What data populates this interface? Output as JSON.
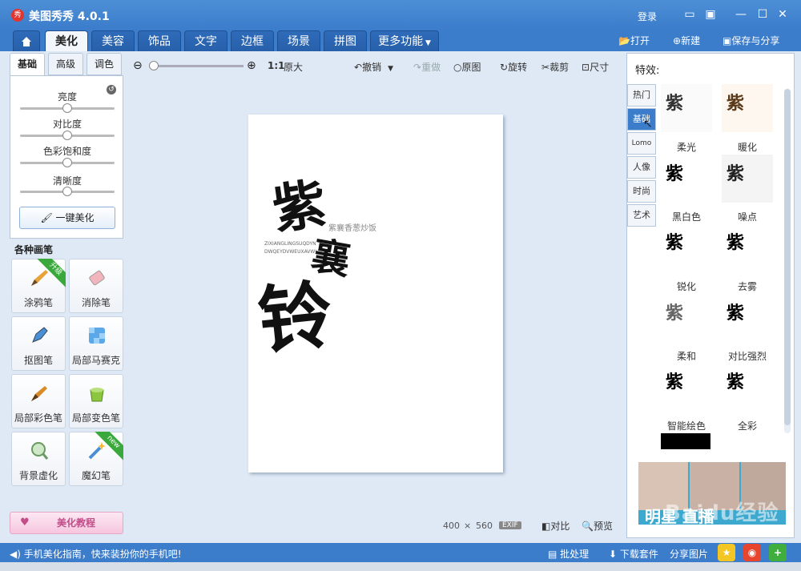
{
  "app": {
    "title": "美图秀秀 4.0.1",
    "logo_text": "秀",
    "login": "登录"
  },
  "menu": {
    "tabs": [
      "美化",
      "美容",
      "饰品",
      "文字",
      "边框",
      "场景",
      "拼图"
    ],
    "more": "更多功能",
    "open": "打开",
    "new": "新建",
    "save": "保存与分享"
  },
  "toolbar": {
    "zoom_ratio": "1:1",
    "original_size": "原大",
    "undo": "撤销",
    "redo": "重做",
    "original": "原图",
    "rotate": "旋转",
    "crop": "裁剪",
    "size": "尺寸"
  },
  "left": {
    "tabs": [
      "基础",
      "高级",
      "调色"
    ],
    "sliders": [
      {
        "label": "亮度",
        "value": 0.5
      },
      {
        "label": "对比度",
        "value": 0.5
      },
      {
        "label": "色彩饱和度",
        "value": 0.5
      },
      {
        "label": "清晰度",
        "value": 0.5
      }
    ],
    "one_key": "一键美化",
    "brushes_header": "各种画笔",
    "brushes": [
      "涂鸦笔",
      "消除笔",
      "抠图笔",
      "局部马赛克",
      "局部彩色笔",
      "局部变色笔",
      "背景虚化",
      "魔幻笔"
    ],
    "badge_upgrade": "升级",
    "badge_new": "new",
    "tutorial": "美化教程"
  },
  "canvas": {
    "artwork": {
      "c1": "紫",
      "c2": "襄",
      "c3": "铃",
      "subtitle": "紫襄香葱炒饭",
      "small1": "ZIXIANGLINGSUQDYN",
      "small2": "DWQEYDVWEUXAVWI"
    },
    "dims_w": "400",
    "dims_x": "×",
    "dims_h": "560",
    "exif": "EXIF",
    "compare": "对比",
    "preview": "预览"
  },
  "right": {
    "title": "特效:",
    "tabs": [
      "热门",
      "基础",
      "Lomo",
      "人像",
      "时尚",
      "艺术"
    ],
    "active_tab": "基础",
    "effects": [
      "柔光",
      "暖化",
      "黑白色",
      "噪点",
      "锐化",
      "去雾",
      "柔和",
      "对比强烈",
      "智能绘色",
      "全彩"
    ],
    "ad_text": "明星 直播"
  },
  "status": {
    "tip": "手机美化指南，快来装扮你的手机吧!",
    "batch": "批处理",
    "download": "下载套件",
    "share": "分享图片"
  },
  "watermark": "Baidu经验",
  "colors": {
    "titlebar": "#3b7ccb",
    "accent": "#3b7ccb",
    "ribbon_green": "#3aa83a"
  }
}
